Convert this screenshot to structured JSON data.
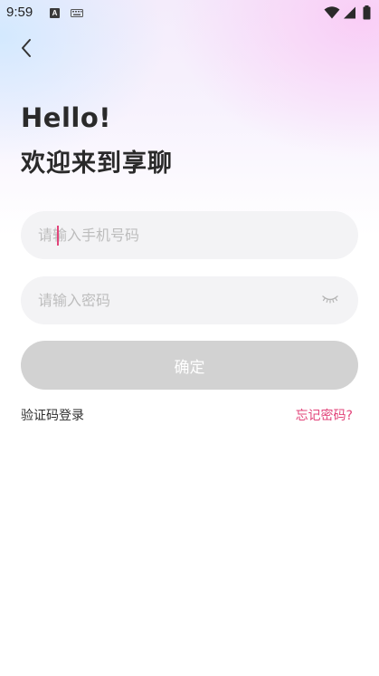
{
  "status_bar": {
    "time": "9:59",
    "notification_icon_letter": "A",
    "icons": [
      "notification-a-icon",
      "keyboard-icon",
      "wifi-icon",
      "signal-icon",
      "battery-icon"
    ]
  },
  "nav": {
    "back_icon": "chevron-left-icon"
  },
  "greeting": {
    "hello": "Hello!",
    "welcome": "欢迎来到享聊"
  },
  "form": {
    "phone_placeholder": "请输入手机号码",
    "phone_value": "",
    "password_placeholder": "请输入密码",
    "password_value": "",
    "password_toggle_icon": "eye-closed-icon",
    "confirm_label": "确定"
  },
  "links": {
    "sms_login": "验证码登录",
    "forgot_password": "忘记密码?"
  },
  "colors": {
    "accent": "#e2447a",
    "button_disabled": "#d2d2d2",
    "input_bg": "#f3f3f5",
    "text_primary": "#2a2a2a",
    "placeholder": "#bdbdbd"
  }
}
